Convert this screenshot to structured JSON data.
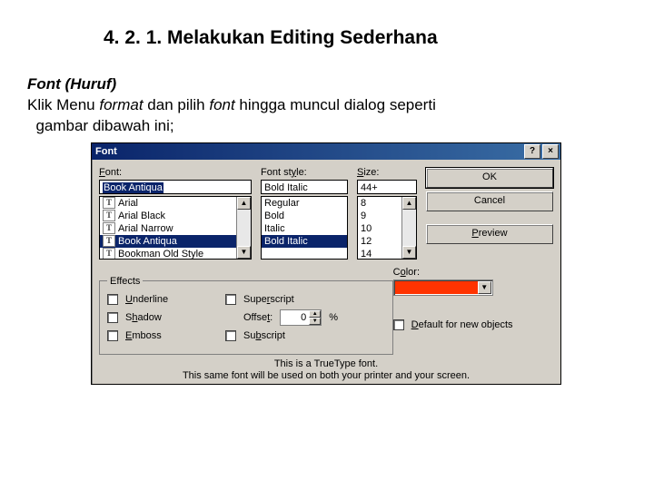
{
  "heading": "4. 2. 1. Melakukan Editing Sederhana",
  "intro": {
    "subhead": "Font (Huruf)",
    "line2a": "Klik Menu ",
    "line2_it1": "format",
    "line2b": "  dan pilih ",
    "line2_it2": "font",
    "line2c": " hingga muncul dialog seperti",
    "line3": "gambar dibawah ini;"
  },
  "dialog": {
    "title": "Font",
    "help": "?",
    "close": "×",
    "labels": {
      "font_pre": "F",
      "font_post": "ont:",
      "style_pre": "Font st",
      "style_u": "y",
      "style_post": "le:",
      "size_pre": "",
      "size_u": "S",
      "size_post": "ize:",
      "color_pre": "C",
      "color_u": "o",
      "color_post": "lor:"
    },
    "font_value": "Book Antiqua",
    "style_value": "Bold Italic",
    "size_value": "44+",
    "fonts": [
      "Arial",
      "Arial Black",
      "Arial Narrow",
      "Book Antiqua",
      "Bookman Old Style"
    ],
    "font_selected_index": 3,
    "styles": [
      "Regular",
      "Bold",
      "Italic",
      "Bold Italic"
    ],
    "style_selected_index": 3,
    "sizes": [
      "8",
      "9",
      "10",
      "12",
      "14"
    ],
    "buttons": {
      "ok": "OK",
      "cancel": "Cancel",
      "preview_u": "P",
      "preview_rest": "review"
    },
    "effects": {
      "legend": "Effects",
      "underline_u": "U",
      "underline_rest": "nderline",
      "shadow_pre": "S",
      "shadow_u": "h",
      "shadow_post": "adow",
      "emboss_u": "E",
      "emboss_rest": "mboss",
      "super_pre": "Supe",
      "super_u": "r",
      "super_post": "script",
      "offset_pre": "Offse",
      "offset_u": "t",
      "offset_post": ":",
      "offset_value": "0",
      "pct": "%",
      "sub_pre": "Su",
      "sub_u": "b",
      "sub_post": "script"
    },
    "color": "#ff3300",
    "default_pre": "",
    "default_u": "D",
    "default_post": "efault for new objects",
    "footer1": "This is a TrueType font.",
    "footer2": "This same font will be used on both your printer and your screen."
  }
}
